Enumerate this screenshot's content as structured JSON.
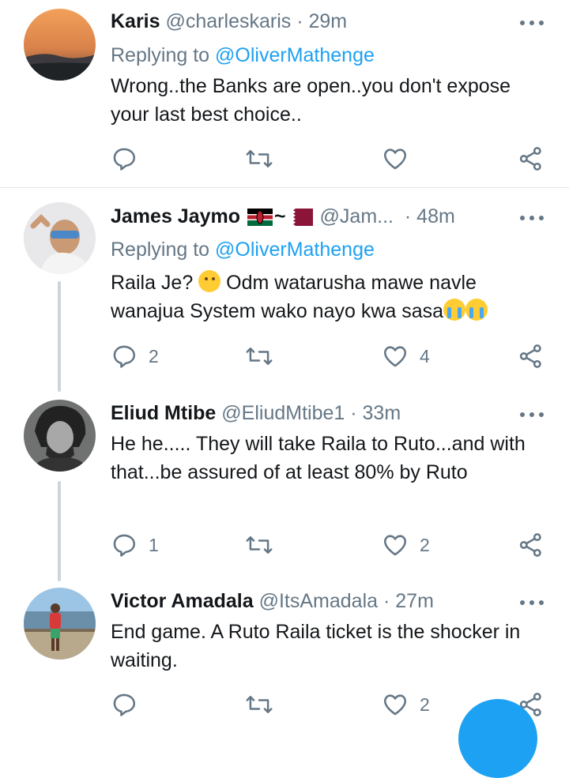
{
  "colors": {
    "accent": "#1da1f2",
    "muted": "#657786",
    "text": "#14171a",
    "divider": "#e1e8ed"
  },
  "tweets": [
    {
      "name": "Karis",
      "handle": "@charleskaris",
      "separator": "·",
      "time": "29m",
      "replying_label": "Replying to",
      "replying_to": "@OliverMathenge",
      "text": "Wrong..the Banks are open..you don't expose your last best choice..",
      "replies": "",
      "likes": ""
    },
    {
      "name": "James Jaymo",
      "name_suffix": "~",
      "handle": "@Jam...",
      "separator": "·",
      "time": "48m",
      "replying_label": "Replying to",
      "replying_to": "@OliverMathenge",
      "text_line1_a": "Raila Je? ",
      "text_line1_b": " Odm watarusha mawe navle",
      "text_line2": "wanajua System wako nayo kwa sasa",
      "replies": "2",
      "likes": "4"
    },
    {
      "name": "Eliud Mtibe",
      "handle": "@EliudMtibe1",
      "separator": "·",
      "time": "33m",
      "text": "He he..... They will take Raila to Ruto...and with that...be assured of at least 80% by Ruto",
      "replies": "1",
      "likes": "2"
    },
    {
      "name": "Victor Amadala",
      "handle": "@ItsAmadala",
      "separator": "·",
      "time": "27m",
      "text": "End game. A Ruto Raila ticket is the shocker in waiting.",
      "replies": "",
      "likes": "2"
    }
  ]
}
